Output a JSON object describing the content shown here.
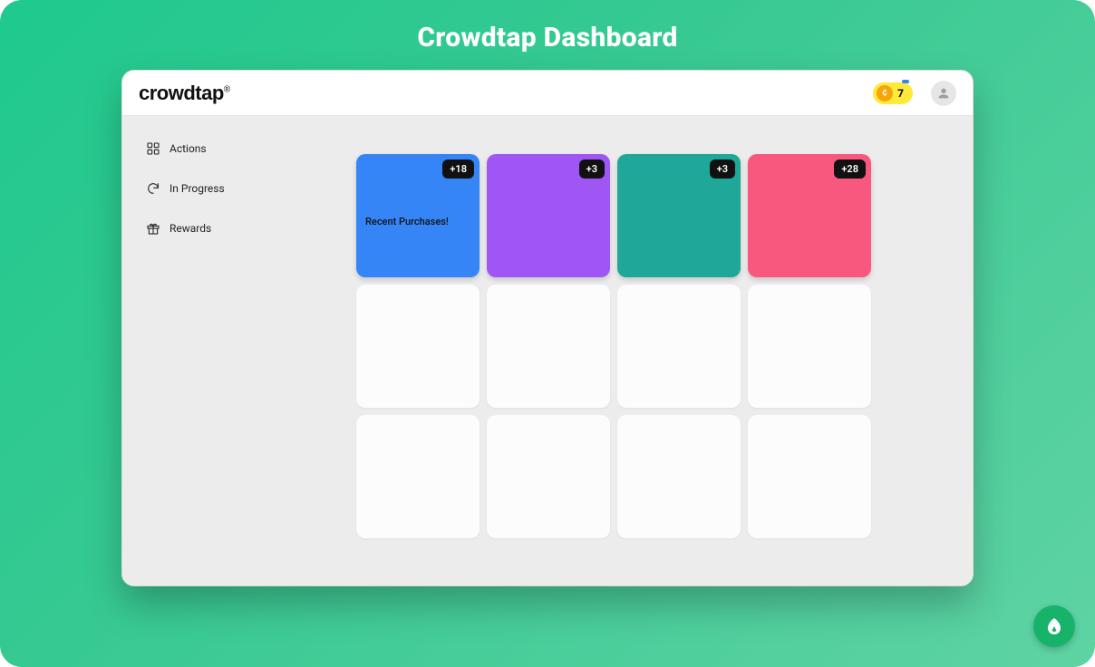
{
  "page": {
    "title": "Crowdtap Dashboard"
  },
  "brand": {
    "name": "crowdtap",
    "reg": "®"
  },
  "header": {
    "coins": "7"
  },
  "sidebar": {
    "items": [
      {
        "label": "Actions"
      },
      {
        "label": "In Progress"
      },
      {
        "label": "Rewards"
      }
    ]
  },
  "tiles": [
    {
      "color": "#3585f7",
      "points": "+18",
      "label": "Recent Purchases!"
    },
    {
      "color": "#a055f5",
      "points": "+3",
      "label": ""
    },
    {
      "color": "#1fa79a",
      "points": "+3",
      "label": ""
    },
    {
      "color": "#f8577e",
      "points": "+28",
      "label": ""
    },
    {
      "color": "",
      "points": "",
      "label": ""
    },
    {
      "color": "",
      "points": "",
      "label": ""
    },
    {
      "color": "",
      "points": "",
      "label": ""
    },
    {
      "color": "",
      "points": "",
      "label": ""
    },
    {
      "color": "",
      "points": "",
      "label": ""
    },
    {
      "color": "",
      "points": "",
      "label": ""
    },
    {
      "color": "",
      "points": "",
      "label": ""
    },
    {
      "color": "",
      "points": "",
      "label": ""
    }
  ]
}
